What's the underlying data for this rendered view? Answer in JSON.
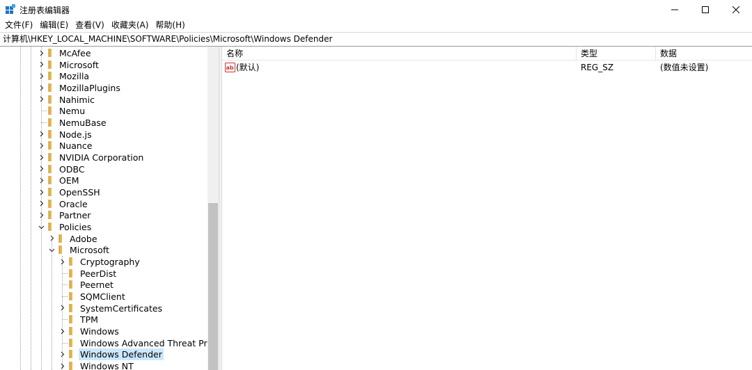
{
  "window": {
    "title": "注册表编辑器",
    "icon": "regedit-icon"
  },
  "menu": [
    "文件(F)",
    "编辑(E)",
    "查看(V)",
    "收藏夹(A)",
    "帮助(H)"
  ],
  "address": "计算机\\HKEY_LOCAL_MACHINE\\SOFTWARE\\Policies\\Microsoft\\Windows Defender",
  "tree": [
    {
      "label": "McAfee",
      "level": 0,
      "expander": "collapsed"
    },
    {
      "label": "Microsoft",
      "level": 0,
      "expander": "collapsed"
    },
    {
      "label": "Mozilla",
      "level": 0,
      "expander": "collapsed"
    },
    {
      "label": "MozillaPlugins",
      "level": 0,
      "expander": "collapsed"
    },
    {
      "label": "Nahimic",
      "level": 0,
      "expander": "collapsed"
    },
    {
      "label": "Nemu",
      "level": 0,
      "expander": "none"
    },
    {
      "label": "NemuBase",
      "level": 0,
      "expander": "none"
    },
    {
      "label": "Node.js",
      "level": 0,
      "expander": "collapsed"
    },
    {
      "label": "Nuance",
      "level": 0,
      "expander": "collapsed"
    },
    {
      "label": "NVIDIA Corporation",
      "level": 0,
      "expander": "collapsed"
    },
    {
      "label": "ODBC",
      "level": 0,
      "expander": "collapsed"
    },
    {
      "label": "OEM",
      "level": 0,
      "expander": "collapsed"
    },
    {
      "label": "OpenSSH",
      "level": 0,
      "expander": "collapsed"
    },
    {
      "label": "Oracle",
      "level": 0,
      "expander": "collapsed"
    },
    {
      "label": "Partner",
      "level": 0,
      "expander": "collapsed"
    },
    {
      "label": "Policies",
      "level": 0,
      "expander": "expanded"
    },
    {
      "label": "Adobe",
      "level": 1,
      "expander": "collapsed"
    },
    {
      "label": "Microsoft",
      "level": 1,
      "expander": "expanded"
    },
    {
      "label": "Cryptography",
      "level": 2,
      "expander": "collapsed"
    },
    {
      "label": "PeerDist",
      "level": 2,
      "expander": "none"
    },
    {
      "label": "Peernet",
      "level": 2,
      "expander": "none"
    },
    {
      "label": "SQMClient",
      "level": 2,
      "expander": "none"
    },
    {
      "label": "SystemCertificates",
      "level": 2,
      "expander": "collapsed"
    },
    {
      "label": "TPM",
      "level": 2,
      "expander": "none"
    },
    {
      "label": "Windows",
      "level": 2,
      "expander": "collapsed"
    },
    {
      "label": "Windows Advanced Threat Prote",
      "level": 2,
      "expander": "none"
    },
    {
      "label": "Windows Defender",
      "level": 2,
      "expander": "collapsed",
      "selected": true
    },
    {
      "label": "Windows NT",
      "level": 2,
      "expander": "collapsed"
    }
  ],
  "list": {
    "columns": [
      "名称",
      "类型",
      "数据"
    ],
    "rows": [
      {
        "name": "(默认)",
        "type": "REG_SZ",
        "data": "(数值未设置)",
        "icon": "string-value-icon"
      }
    ]
  },
  "colors": {
    "selection": "#cce8ff",
    "folder": "#e8b84a",
    "scroll_thumb": "#c2c2c2"
  }
}
